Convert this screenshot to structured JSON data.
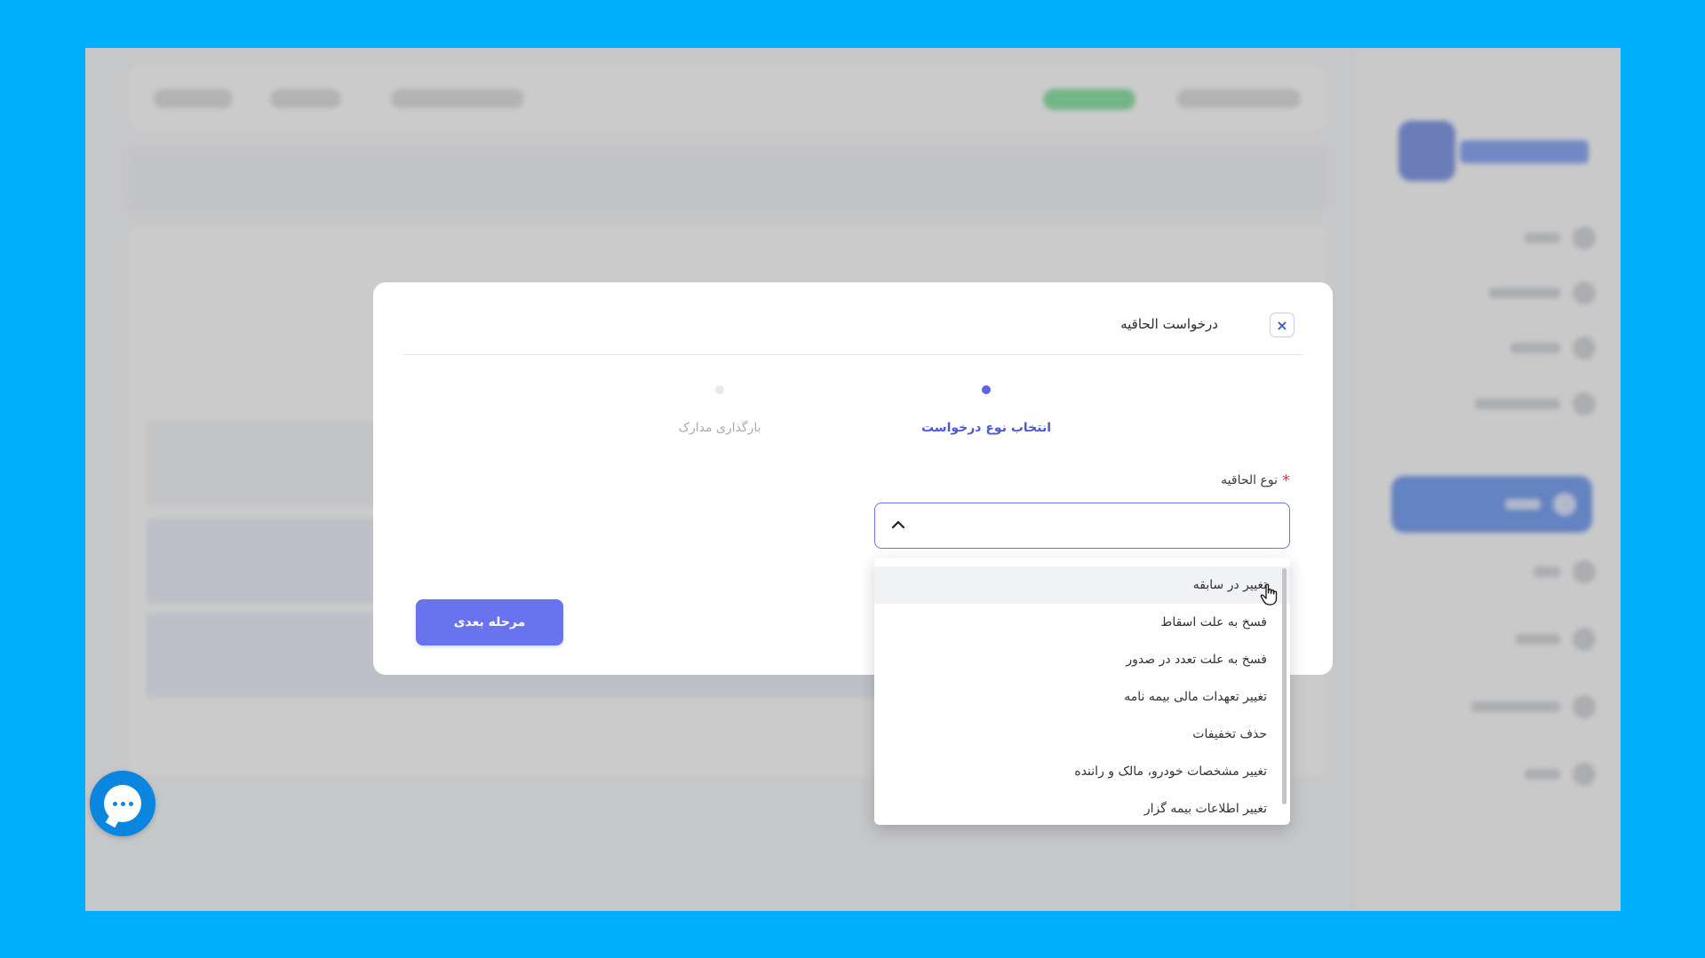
{
  "modal": {
    "title": "درخواست الحاقیه",
    "close_icon": "×",
    "steps": [
      {
        "label": "انتخاب نوع درخواست",
        "state": "active"
      },
      {
        "label": "بارگذاری مدارک",
        "state": "inactive"
      }
    ],
    "field": {
      "label": "نوع الحاقیه",
      "required_mark": "*",
      "value": "",
      "expanded": true
    },
    "next_button": "مرحله بعدی"
  },
  "dropdown": {
    "options": [
      "تغییر در سابقه",
      "فسخ به علت اسقاط",
      "فسخ به علت تعدد در صدور",
      "تغییر تعهدات مالی بیمه نامه",
      "حذف تخفیفات",
      "تغییر مشخصات خودرو، مالک و راننده",
      "تغییر اطلاعات بیمه گزار"
    ],
    "hovered_index": 0
  },
  "colors": {
    "accent": "#6a73ee",
    "step_active": "#5b64e6",
    "required": "#e0384c",
    "background": "#00b0ff",
    "chat": "#0a86e0"
  },
  "icons": {
    "close": "close-icon",
    "select": "chevron-up-icon",
    "chat": "chat-icon",
    "cursor": "hand-pointer-icon"
  }
}
